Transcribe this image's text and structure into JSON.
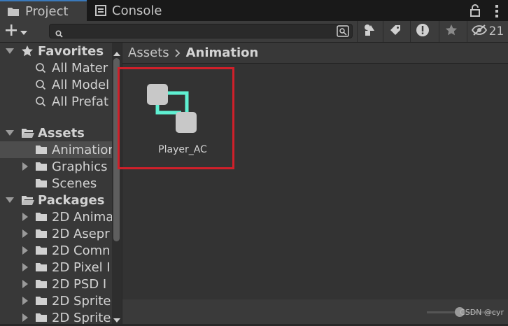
{
  "tabs": [
    {
      "label": "Project",
      "icon": "folder-icon",
      "active": true
    },
    {
      "label": "Console",
      "icon": "console-icon",
      "active": false
    }
  ],
  "toolbar": {
    "search_value": "",
    "hidden_count": "21"
  },
  "tree": {
    "favorites": {
      "label": "Favorites",
      "items": [
        "All Mater",
        "All Model",
        "All Prefat"
      ]
    },
    "assets": {
      "label": "Assets",
      "items": [
        {
          "label": "Animation",
          "selected": true,
          "expandable": false
        },
        {
          "label": "Graphics",
          "selected": false,
          "expandable": true
        },
        {
          "label": "Scenes",
          "selected": false,
          "expandable": false
        }
      ]
    },
    "packages": {
      "label": "Packages",
      "items": [
        "2D Anima",
        "2D Asepr",
        "2D Comn",
        "2D Pixel I",
        "2D PSD I",
        "2D Sprite",
        "2D Sprite"
      ]
    }
  },
  "breadcrumb": [
    "Assets",
    "Animation"
  ],
  "assets_grid": [
    {
      "name": "Player_AC",
      "icon": "animator-controller-icon"
    }
  ],
  "footer": {
    "watermark": "CSDN @cyr"
  },
  "colors": {
    "accent_teal": "#5ff0d2",
    "highlight_red": "#d0202a",
    "tab_active_line": "#3a79bb"
  }
}
